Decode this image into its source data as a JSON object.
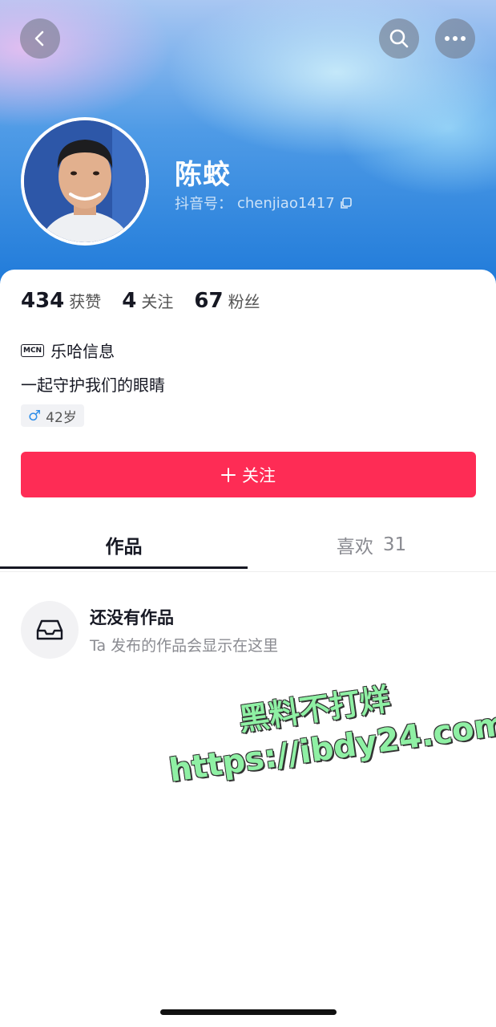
{
  "profile": {
    "name": "陈蛟",
    "douyin_id_label": "抖音号：",
    "douyin_id": "chenjiao1417"
  },
  "stats": [
    {
      "value": "434",
      "label": "获赞"
    },
    {
      "value": "4",
      "label": "关注"
    },
    {
      "value": "67",
      "label": "粉丝"
    }
  ],
  "mcn": {
    "badge": "MCN",
    "label": "乐哈信息"
  },
  "bio": "一起守护我们的眼睛",
  "tag": {
    "gender_symbol": "♂",
    "age": "42岁"
  },
  "follow_button": {
    "label": "关注"
  },
  "tabs": [
    {
      "label": "作品",
      "count": ""
    },
    {
      "label": "喜欢",
      "count": "31"
    }
  ],
  "empty_state": {
    "title": "还没有作品",
    "subtitle": "Ta 发布的作品会显示在这里"
  },
  "watermark": {
    "line1": "黑料不打烊",
    "line2": "https://ibdy24.com"
  },
  "colors": {
    "accent": "#fe2c55",
    "header_blue": "#1f7ad9"
  },
  "icons": {
    "back": "chevron-left-icon",
    "search": "search-icon",
    "more": "more-dots-icon",
    "copy": "copy-icon",
    "empty": "inbox-icon"
  }
}
